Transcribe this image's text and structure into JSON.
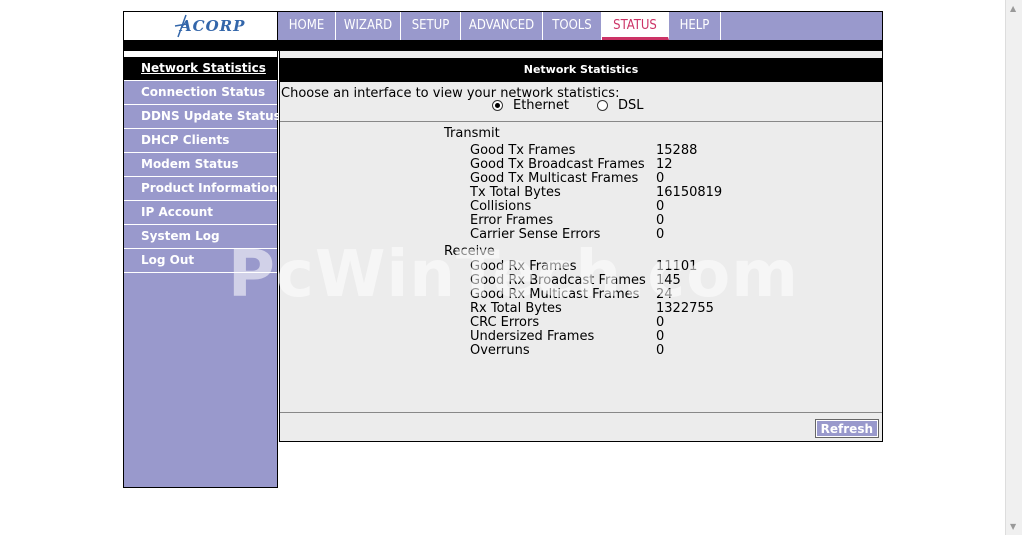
{
  "logo": {
    "text": "ACORP"
  },
  "nav": [
    {
      "label": "HOME",
      "w": 58
    },
    {
      "label": "WIZARD",
      "w": 65
    },
    {
      "label": "SETUP",
      "w": 60
    },
    {
      "label": "ADVANCED",
      "w": 82
    },
    {
      "label": "TOOLS",
      "w": 59
    },
    {
      "label": "STATUS",
      "w": 67
    },
    {
      "label": "HELP",
      "w": 52
    }
  ],
  "sidebar": [
    "Network Statistics",
    "Connection Status",
    "DDNS Update Status",
    "DHCP Clients",
    "Modem Status",
    "Product Information",
    "IP Account",
    "System Log",
    "Log Out"
  ],
  "content": {
    "title": "Network Statistics",
    "choose": "Choose an interface to view your network statistics:",
    "radio_ethernet": "Ethernet",
    "radio_dsl": "DSL",
    "transmit_label": "Transmit",
    "transmit": [
      {
        "name": "Good Tx Frames",
        "value": "15288"
      },
      {
        "name": "Good Tx Broadcast Frames",
        "value": "12"
      },
      {
        "name": "Good Tx Multicast Frames",
        "value": "0"
      },
      {
        "name": "Tx Total Bytes",
        "value": "16150819"
      },
      {
        "name": "Collisions",
        "value": "0"
      },
      {
        "name": "Error Frames",
        "value": "0"
      },
      {
        "name": "Carrier Sense Errors",
        "value": "0"
      }
    ],
    "receive_label": "Receive",
    "receive": [
      {
        "name": "Good Rx Frames",
        "value": "11101"
      },
      {
        "name": "Good Rx Broadcast Frames",
        "value": "145"
      },
      {
        "name": "Good Rx Multicast Frames",
        "value": "24"
      },
      {
        "name": "Rx Total Bytes",
        "value": "1322755"
      },
      {
        "name": "CRC Errors",
        "value": "0"
      },
      {
        "name": "Undersized Frames",
        "value": "0"
      },
      {
        "name": "Overruns",
        "value": "0"
      }
    ],
    "refresh": "Refresh"
  },
  "watermark": "PcWinTech.com"
}
